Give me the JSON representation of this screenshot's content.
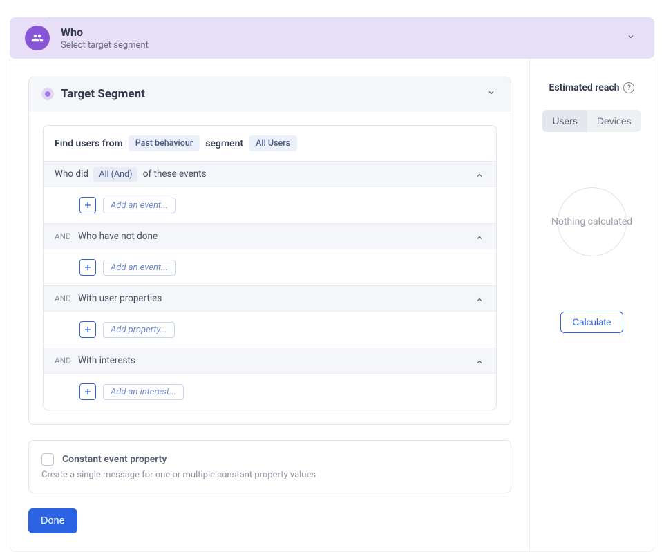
{
  "header": {
    "title": "Who",
    "subtitle": "Select target segment"
  },
  "target_card": {
    "title": "Target Segment",
    "find": {
      "prefix": "Find users from",
      "behaviour_chip": "Past behaviour",
      "middle": "segment",
      "segment_chip": "All Users"
    },
    "conditions": [
      {
        "and_label": "",
        "text_before": "Who did",
        "boxed": "All (And)",
        "text_after": "of these events",
        "add_label": "Add an event..."
      },
      {
        "and_label": "AND",
        "text_before": "Who have not done",
        "boxed": "",
        "text_after": "",
        "add_label": "Add an event..."
      },
      {
        "and_label": "AND",
        "text_before": "With user properties",
        "boxed": "",
        "text_after": "",
        "add_label": "Add property..."
      },
      {
        "and_label": "AND",
        "text_before": "With interests",
        "boxed": "",
        "text_after": "",
        "add_label": "Add an interest..."
      }
    ]
  },
  "constant": {
    "title": "Constant event property",
    "subtitle": "Create a single message for one or multiple constant property values"
  },
  "done_label": "Done",
  "right": {
    "reach_label": "Estimated reach",
    "tabs": {
      "users": "Users",
      "devices": "Devices"
    },
    "nothing": "Nothing calculated",
    "calculate": "Calculate"
  }
}
